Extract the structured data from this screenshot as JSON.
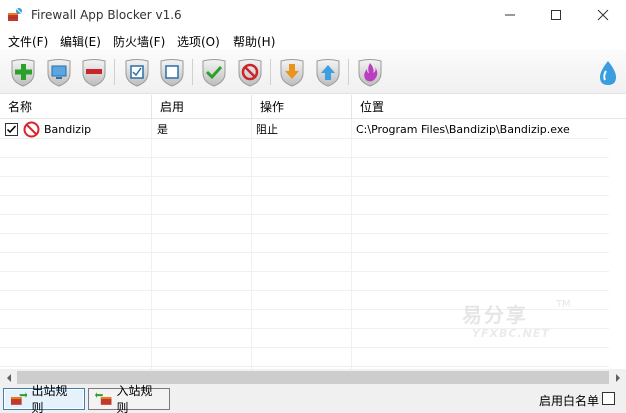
{
  "window": {
    "title": "Firewall App Blocker v1.6"
  },
  "menu": [
    {
      "label": "文件(F)"
    },
    {
      "label": "编辑(E)"
    },
    {
      "label": "防火墙(F)"
    },
    {
      "label": "选项(O)"
    },
    {
      "label": "帮助(H)"
    }
  ],
  "toolbar": {
    "buttons": [
      {
        "icon": "add-icon"
      },
      {
        "icon": "monitor-icon"
      },
      {
        "icon": "remove-icon"
      },
      {
        "icon": "check-all-icon"
      },
      {
        "icon": "uncheck-all-icon"
      },
      {
        "icon": "allow-icon"
      },
      {
        "icon": "block-icon"
      },
      {
        "icon": "move-down-icon"
      },
      {
        "icon": "move-up-icon"
      },
      {
        "icon": "firewall-flame-icon"
      }
    ],
    "brand_icon": "water-drop-icon"
  },
  "list": {
    "columns": [
      "名称",
      "启用",
      "操作",
      "位置"
    ],
    "rows": [
      {
        "name": "Bandizip",
        "enabled": "是",
        "action": "阻止",
        "path": "C:\\Program Files\\Bandizip\\Bandizip.exe",
        "checked": true
      }
    ]
  },
  "watermark": {
    "text": "易分享",
    "tm": "TM",
    "sub": "YFXBC.NET"
  },
  "status": {
    "outbound_label": "出站规则",
    "inbound_label": "入站规则",
    "whitelist_label": "启用白名单"
  },
  "colors": {
    "accent_blue": "#3c7fb1",
    "block_red": "#d9252a",
    "add_green": "#2aa12a"
  }
}
